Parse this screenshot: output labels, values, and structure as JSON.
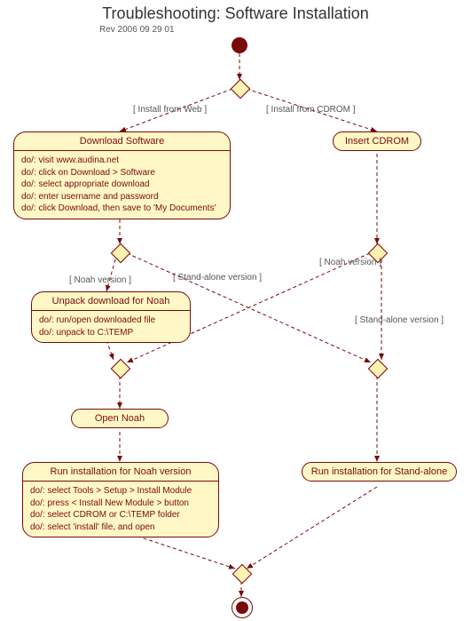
{
  "title": "Troubleshooting: Software Installation",
  "revision": "Rev 2006 09 29 01",
  "guards": {
    "install_web": "[ Install from Web ]",
    "install_cd": "[ Install from CDROM ]",
    "noah_left": "[ Noah version ]",
    "noah_right": "[ Noah version ]",
    "standalone_left": "[ Stand-alone version ]",
    "standalone_right": "[ Stand-alone version ]"
  },
  "activities": {
    "download": {
      "title": "Download Software",
      "lines": [
        "do/: visit www.audina.net",
        "do/: click on Download > Software",
        "do/: select appropriate download",
        "do/: enter username and password",
        "do/: click Download, then save to 'My Documents'"
      ]
    },
    "insert_cd": {
      "title": "Insert CDROM"
    },
    "unpack": {
      "title": "Unpack download for Noah",
      "lines": [
        "do/: run/open downloaded file",
        "do/: unpack to C:\\TEMP"
      ]
    },
    "open_noah": {
      "title": "Open Noah"
    },
    "run_noah": {
      "title": "Run installation for Noah version",
      "lines": [
        "do/: select Tools > Setup > Install Module",
        "do/: press < Install New Module > button",
        "do/: select CDROM or C:\\TEMP folder",
        "do/: select 'install' file, and open"
      ]
    },
    "run_standalone": {
      "title": "Run installation for Stand-alone"
    }
  },
  "colors": {
    "node_border": "#7a0a0a",
    "node_fill": "#fff8c6"
  }
}
